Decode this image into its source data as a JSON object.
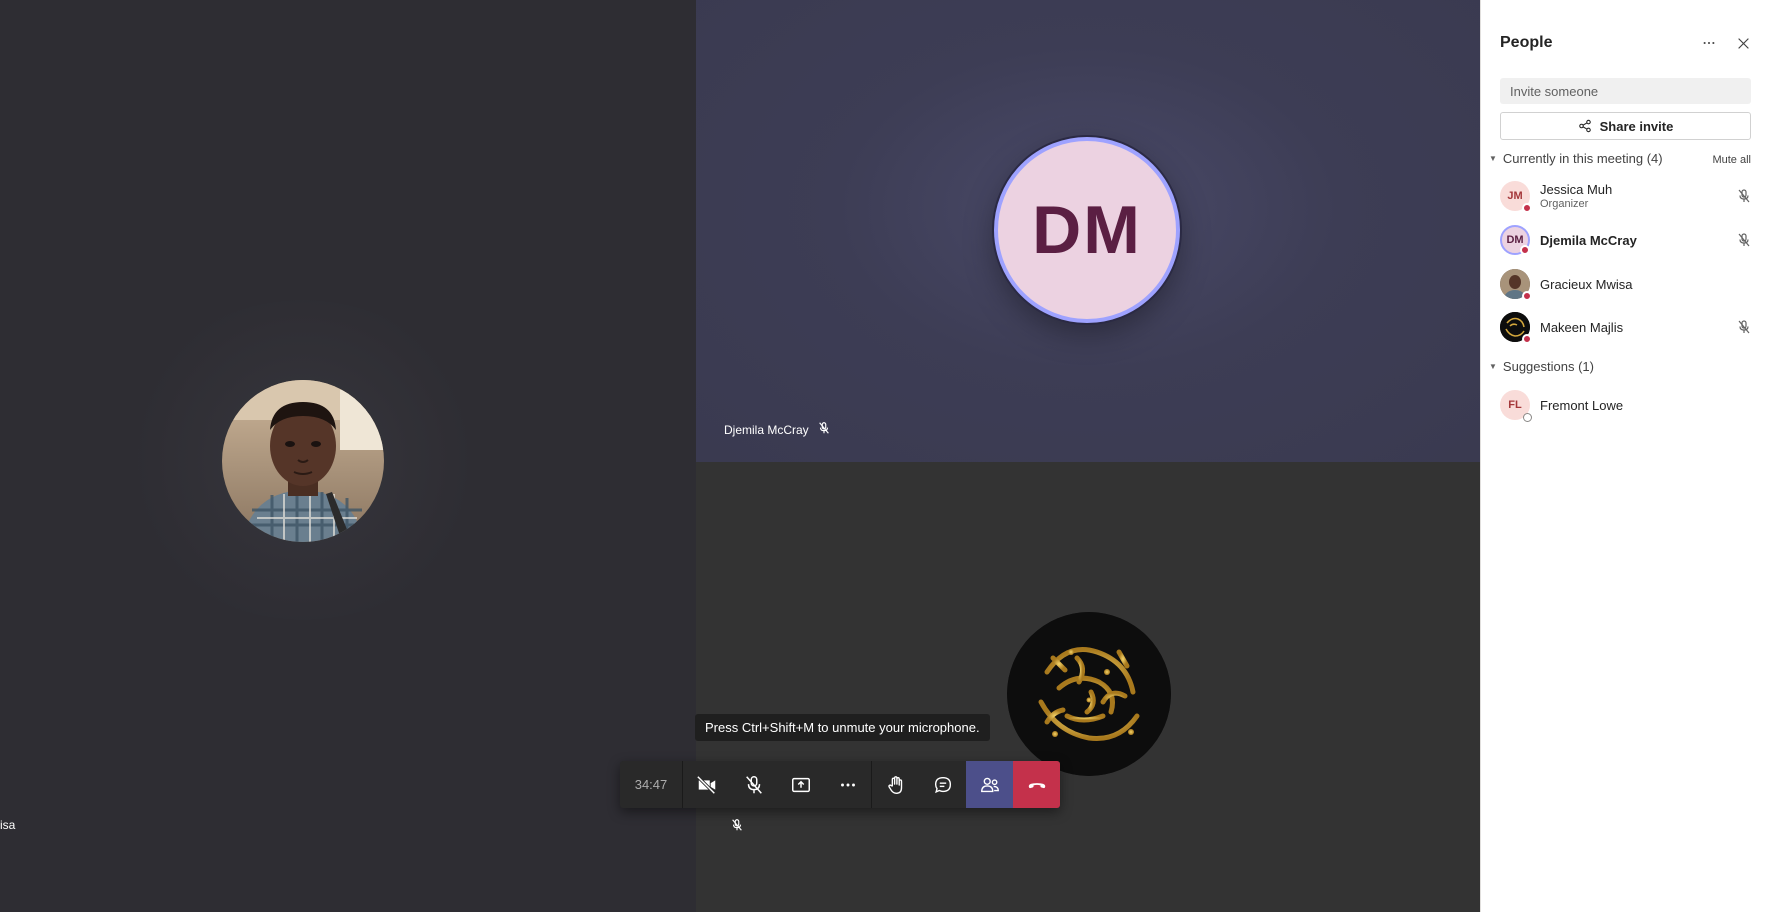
{
  "stage": {
    "tiles": {
      "left": {
        "name_fragment": "isa"
      },
      "top_right": {
        "initials": "DM",
        "name": "Djemila McCray"
      },
      "bottom_right": {}
    },
    "tooltip": "Press Ctrl+Shift+M to unmute your microphone."
  },
  "toolbar": {
    "timer": "34:47",
    "buttons": [
      {
        "id": "camera",
        "icon": "camera-off-icon"
      },
      {
        "id": "mic",
        "icon": "mic-off-icon"
      },
      {
        "id": "share",
        "icon": "share-screen-icon"
      },
      {
        "id": "more",
        "icon": "more-icon"
      },
      {
        "id": "raise-hand",
        "icon": "hand-icon"
      },
      {
        "id": "chat",
        "icon": "chat-icon"
      },
      {
        "id": "people",
        "icon": "people-icon",
        "active": true
      },
      {
        "id": "hang-up",
        "icon": "hang-up-icon",
        "color": "#c4314b"
      }
    ],
    "accent": "#4c4f8a"
  },
  "panel": {
    "title": "People",
    "invite_placeholder": "Invite someone",
    "share_invite": "Share invite",
    "current_section": "Currently in this meeting (4)",
    "mute_all": "Mute all",
    "participants": [
      {
        "initials": "JM",
        "name": "Jessica Muh",
        "role": "Organizer",
        "muted": true
      },
      {
        "initials": "DM",
        "name": "Djemila McCray",
        "role": "",
        "muted": true
      },
      {
        "initials": "",
        "name": "Gracieux Mwisa",
        "role": "",
        "muted": false
      },
      {
        "initials": "",
        "name": "Makeen Majlis",
        "role": "",
        "muted": true
      }
    ],
    "suggestions_section": "Suggestions (1)",
    "suggestions": [
      {
        "initials": "FL",
        "name": "Fremont Lowe"
      }
    ]
  },
  "colors": {
    "status_busy": "#c4314b",
    "dm_avatar_bg": "#ecd2e1",
    "dm_avatar_text": "#5b1f43",
    "speaking_ring": "#9ea2ff"
  }
}
